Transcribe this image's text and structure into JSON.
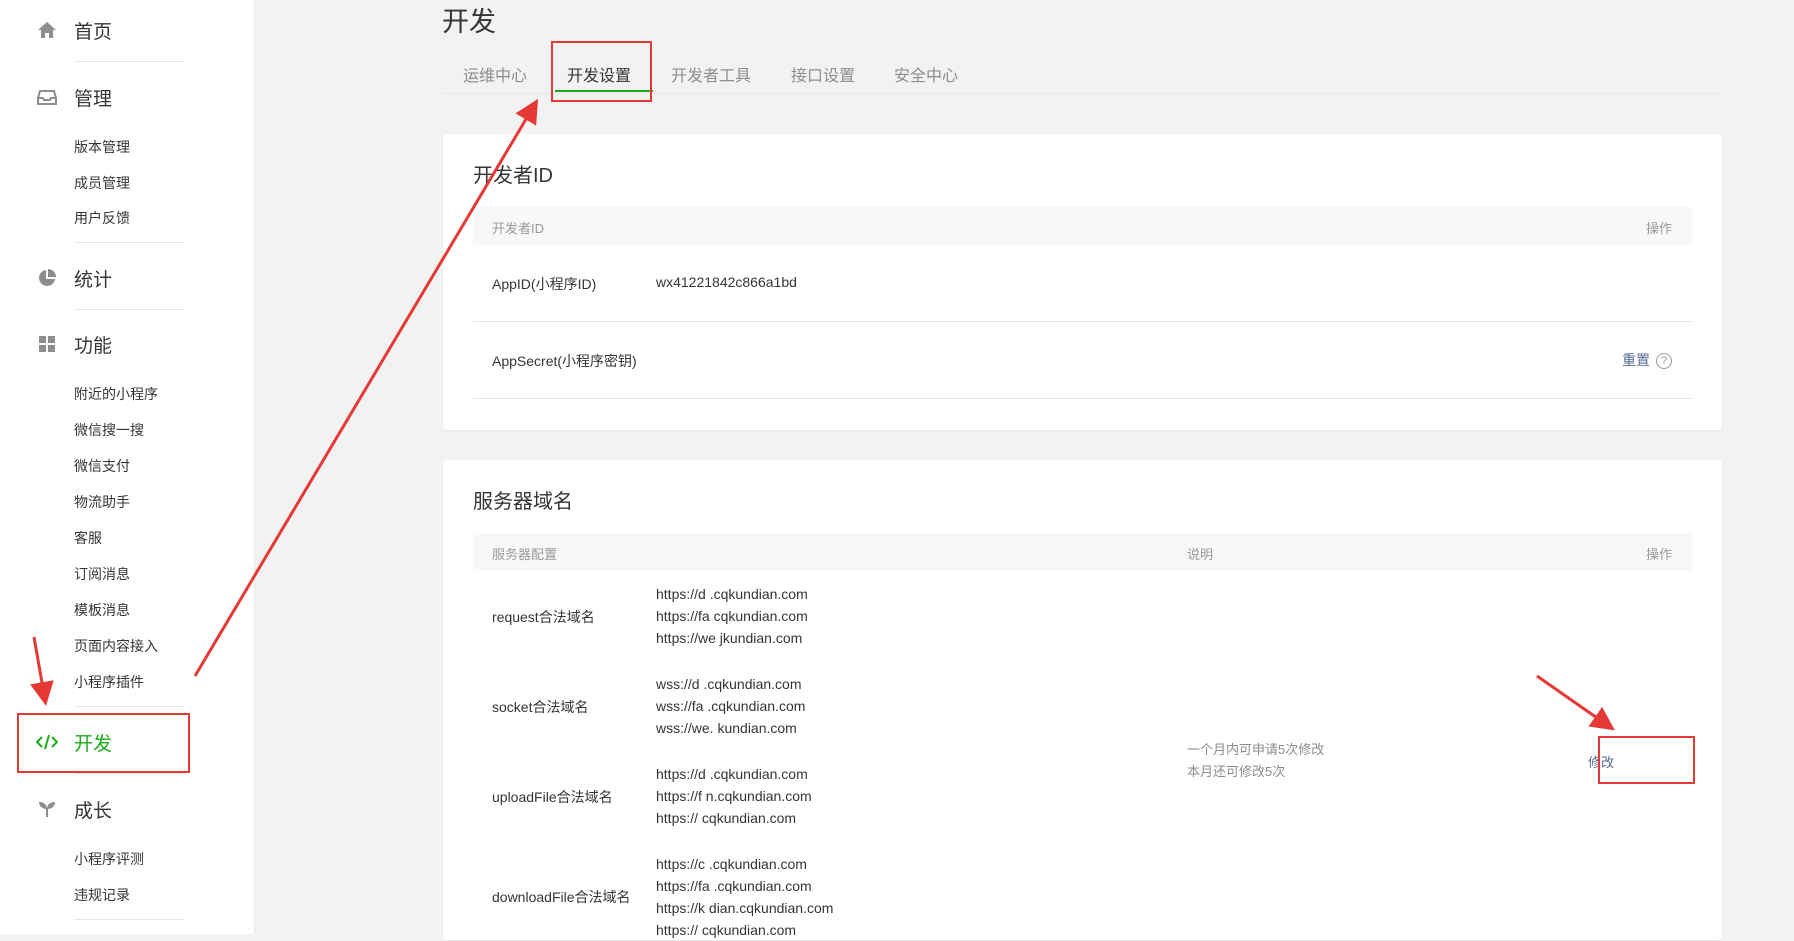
{
  "sidebar": {
    "home": "首页",
    "manage": {
      "label": "管理",
      "items": [
        "版本管理",
        "成员管理",
        "用户反馈"
      ]
    },
    "stats": "统计",
    "features": {
      "label": "功能",
      "items": [
        "附近的小程序",
        "微信搜一搜",
        "微信支付",
        "物流助手",
        "客服",
        "订阅消息",
        "模板消息",
        "页面内容接入",
        "小程序插件"
      ]
    },
    "develop": "开发",
    "growth": {
      "label": "成长",
      "items": [
        "小程序评测",
        "违规记录"
      ]
    }
  },
  "page": {
    "title": "开发",
    "tabs": [
      "运维中心",
      "开发设置",
      "开发者工具",
      "接口设置",
      "安全中心"
    ],
    "active_tab": "开发设置"
  },
  "developer_id": {
    "title": "开发者ID",
    "col_name": "开发者ID",
    "col_action": "操作",
    "appid_label": "AppID(小程序ID)",
    "appid_value": "wx41221842c866a1bd",
    "secret_label": "AppSecret(小程序密钥)",
    "reset_label": "重置",
    "help_glyph": "?"
  },
  "server_domain": {
    "title": "服务器域名",
    "col_config": "服务器配置",
    "col_desc": "说明",
    "col_action": "操作",
    "request_label": "request合法域名",
    "request_domains": [
      "https://d   .cqkundian.com",
      "https://fa   cqkundian.com",
      "https://we   jkundian.com"
    ],
    "socket_label": "socket合法域名",
    "socket_domains": [
      "wss://d   .cqkundian.com",
      "wss://fa   .cqkundian.com",
      "wss://we.   kundian.com"
    ],
    "upload_label": "uploadFile合法域名",
    "upload_domains": [
      "https://d   .cqkundian.com",
      "https://f   n.cqkundian.com",
      "https://   cqkundian.com"
    ],
    "download_label": "downloadFile合法域名",
    "download_domains": [
      "https://c   .cqkundian.com",
      "https://fa   .cqkundian.com",
      "https://k   dian.cqkundian.com",
      "https://   cqkundian.com"
    ],
    "note_line1": "一个月内可申请5次修改",
    "note_line2": "本月还可修改5次",
    "modify_label": "修改"
  },
  "colors": {
    "accent_green": "#1aad19",
    "link_blue": "#576b95",
    "annotation_red": "#e53935"
  }
}
